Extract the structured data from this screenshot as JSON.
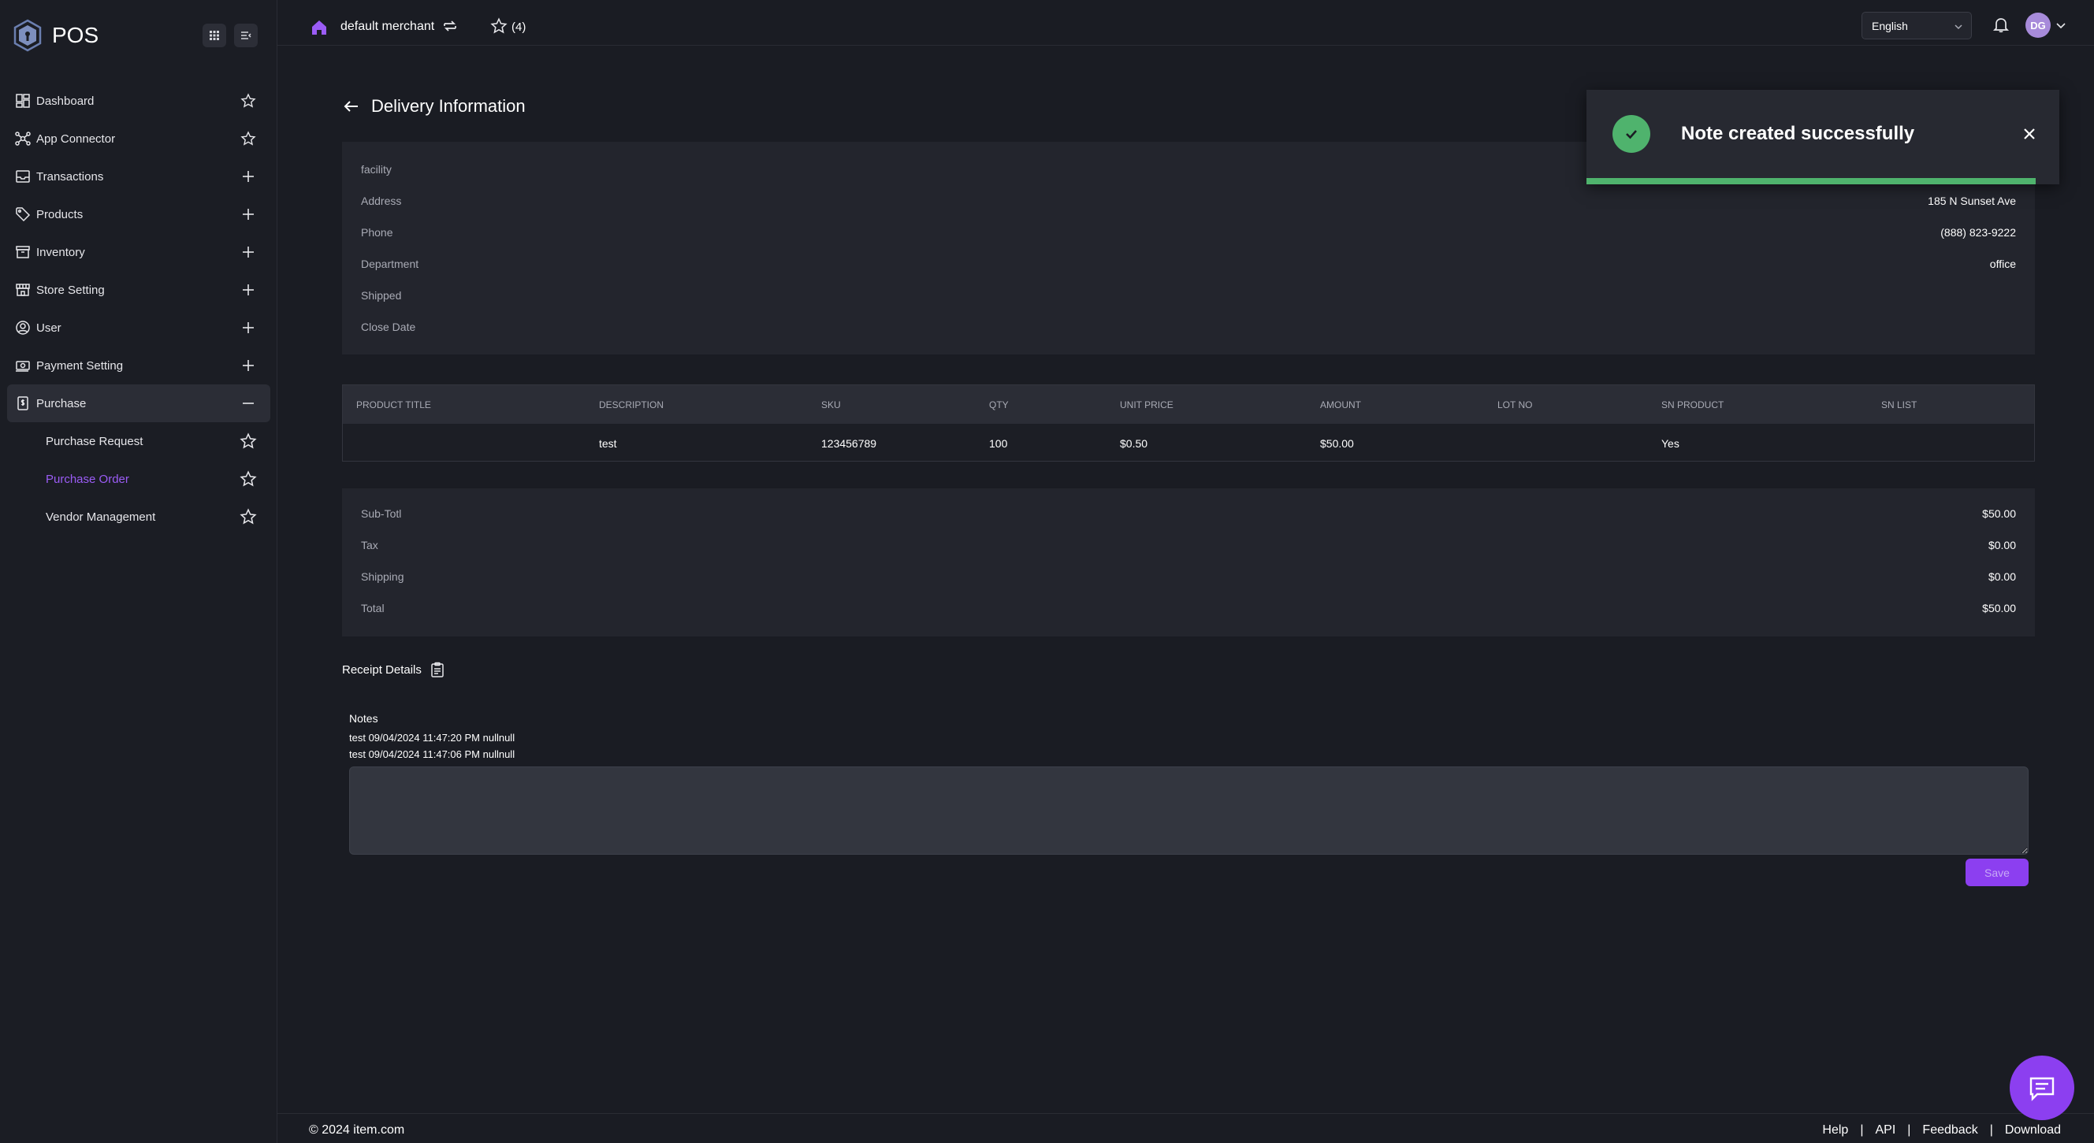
{
  "app": {
    "name": "POS"
  },
  "header": {
    "merchant": "default merchant",
    "favorites_count": "(4)",
    "language": "English",
    "avatar_initials": "DG"
  },
  "sidebar": {
    "items": [
      {
        "label": "Dashboard",
        "icon": "dashboard-icon",
        "action": "star"
      },
      {
        "label": "App Connector",
        "icon": "app-connector-icon",
        "action": "star"
      },
      {
        "label": "Transactions",
        "icon": "transactions-icon",
        "action": "plus"
      },
      {
        "label": "Products",
        "icon": "tag-icon",
        "action": "plus"
      },
      {
        "label": "Inventory",
        "icon": "inventory-icon",
        "action": "plus"
      },
      {
        "label": "Store Setting",
        "icon": "store-icon",
        "action": "plus"
      },
      {
        "label": "User",
        "icon": "user-icon",
        "action": "plus"
      },
      {
        "label": "Payment Setting",
        "icon": "payment-icon",
        "action": "plus"
      },
      {
        "label": "Purchase",
        "icon": "purchase-icon",
        "action": "minus"
      }
    ],
    "purchase_sub": [
      {
        "label": "Purchase Request"
      },
      {
        "label": "Purchase Order"
      },
      {
        "label": "Vendor Management"
      }
    ],
    "selected_sub": "Purchase Order"
  },
  "page": {
    "title": "Delivery Information"
  },
  "info": {
    "rows": [
      {
        "label": "facility",
        "value": ""
      },
      {
        "label": "Address",
        "value": "185 N Sunset Ave"
      },
      {
        "label": "Phone",
        "value": "(888) 823-9222"
      },
      {
        "label": "Department",
        "value": "office"
      },
      {
        "label": "Shipped",
        "value": ""
      },
      {
        "label": "Close Date",
        "value": ""
      }
    ]
  },
  "table": {
    "headers": [
      "PRODUCT TITLE",
      "DESCRIPTION",
      "SKU",
      "QTY",
      "UNIT PRICE",
      "AMOUNT",
      "LOT NO",
      "SN PRODUCT",
      "SN LIST"
    ],
    "rows": [
      [
        "",
        "test",
        "123456789",
        "100",
        "$0.50",
        "$50.00",
        "",
        "Yes",
        ""
      ]
    ]
  },
  "summary": {
    "rows": [
      {
        "label": "Sub-Totl",
        "value": "$50.00"
      },
      {
        "label": "Tax",
        "value": "$0.00"
      },
      {
        "label": "Shipping",
        "value": "$0.00"
      },
      {
        "label": "Total",
        "value": "$50.00"
      }
    ]
  },
  "receipt": {
    "label": "Receipt Details"
  },
  "notes": {
    "label": "Notes",
    "entries": [
      "test 09/04/2024 11:47:20 PM nullnull",
      "test 09/04/2024 11:47:06 PM nullnull"
    ],
    "input_value": "",
    "save_label": "Save"
  },
  "toast": {
    "message": "Note created successfully",
    "progress_fraction": 0.95
  },
  "footer": {
    "copyright": "© 2024 item.com",
    "links": [
      "Help",
      "API",
      "Feedback",
      "Download"
    ]
  },
  "colors": {
    "accent": "#8c3ff0",
    "success": "#4fb36d",
    "background": "#1a1c23"
  }
}
